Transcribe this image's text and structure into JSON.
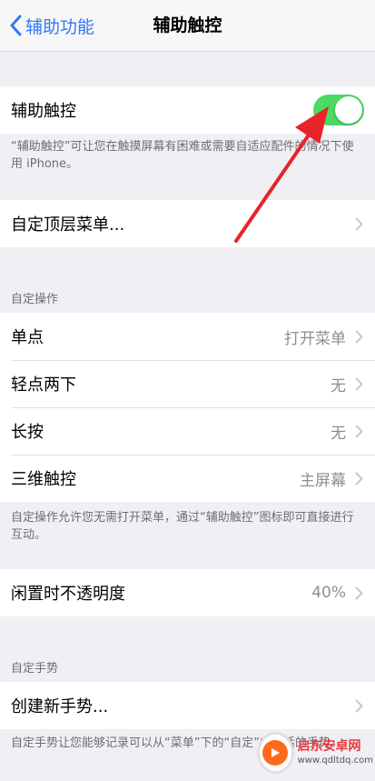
{
  "nav": {
    "back_label": "辅助功能",
    "title": "辅助触控"
  },
  "assistive_touch": {
    "label": "辅助触控",
    "enabled": true,
    "footnote": "“辅助触控”可让您在触摸屏幕有困难或需要自适应配件的情况下使用 iPhone。"
  },
  "top_menu": {
    "label": "自定顶层菜单..."
  },
  "custom_actions": {
    "header": "自定操作",
    "rows": [
      {
        "label": "单点",
        "value": "打开菜单"
      },
      {
        "label": "轻点两下",
        "value": "无"
      },
      {
        "label": "长按",
        "value": "无"
      },
      {
        "label": "三维触控",
        "value": "主屏幕"
      }
    ],
    "footnote": "自定操作允许您无需打开菜单，通过“辅助触控”图标即可直接进行互动。"
  },
  "idle_opacity": {
    "label": "闲置时不透明度",
    "value": "40%"
  },
  "custom_gestures": {
    "header": "自定手势",
    "create_label": "创建新手势...",
    "footnote": "自定手势让您能够记录可以从“菜单”下的“自定”中激活的手势。"
  },
  "watermark": {
    "name": "启东安卓网",
    "url": "www.qdltdq.com"
  },
  "colors": {
    "accent": "#3478f6",
    "toggle_on": "#4cd964",
    "arrow": "#e8232a"
  }
}
